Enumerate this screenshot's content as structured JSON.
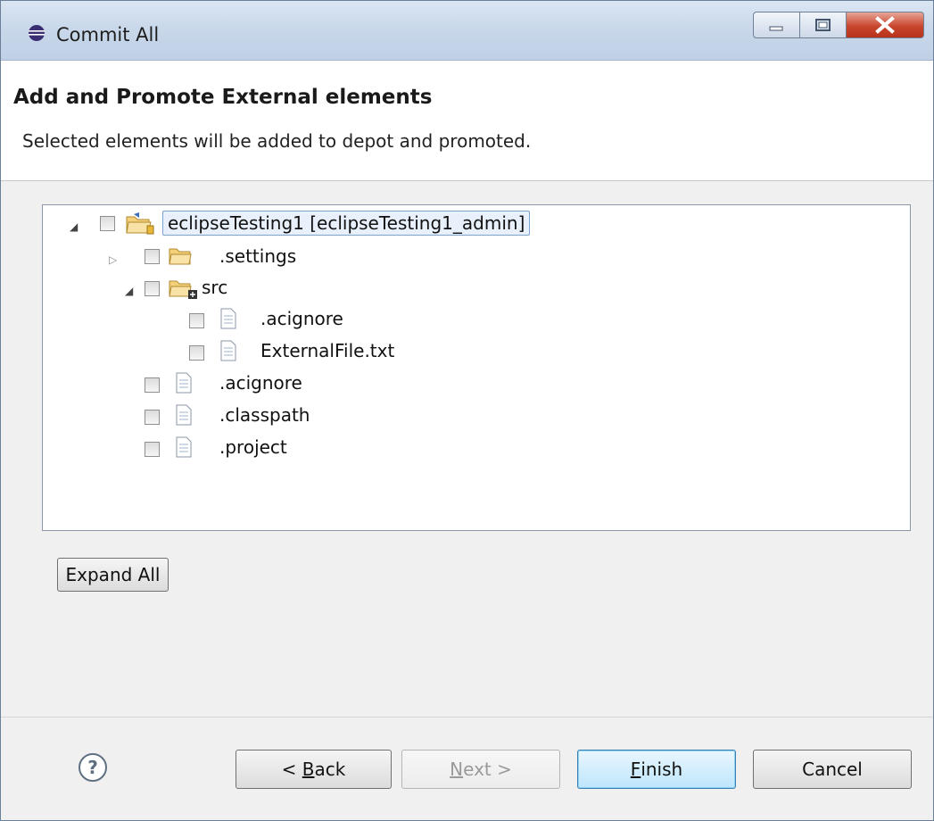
{
  "window": {
    "title": "Commit All"
  },
  "header": {
    "title": "Add and Promote External elements",
    "description": "Selected elements will be added to depot and promoted."
  },
  "tree": {
    "root": "eclipseTesting1 [eclipseTesting1_admin]",
    "settings": ".settings",
    "src": "src",
    "src_acignore": ".acignore",
    "src_external": "ExternalFile.txt",
    "acignore": ".acignore",
    "classpath": ".classpath",
    "project": ".project"
  },
  "buttons": {
    "expand_all": "Expand All",
    "back_prefix": "< ",
    "back_mnemonic": "B",
    "back_rest": "ack",
    "next_mnemonic": "N",
    "next_rest": "ext >",
    "finish_mnemonic": "F",
    "finish_rest": "inish",
    "cancel": "Cancel",
    "help_glyph": "?"
  },
  "colors": {
    "accent": "#3c7fb1",
    "selection": "#7da2ce",
    "folder": "#f2c458"
  }
}
